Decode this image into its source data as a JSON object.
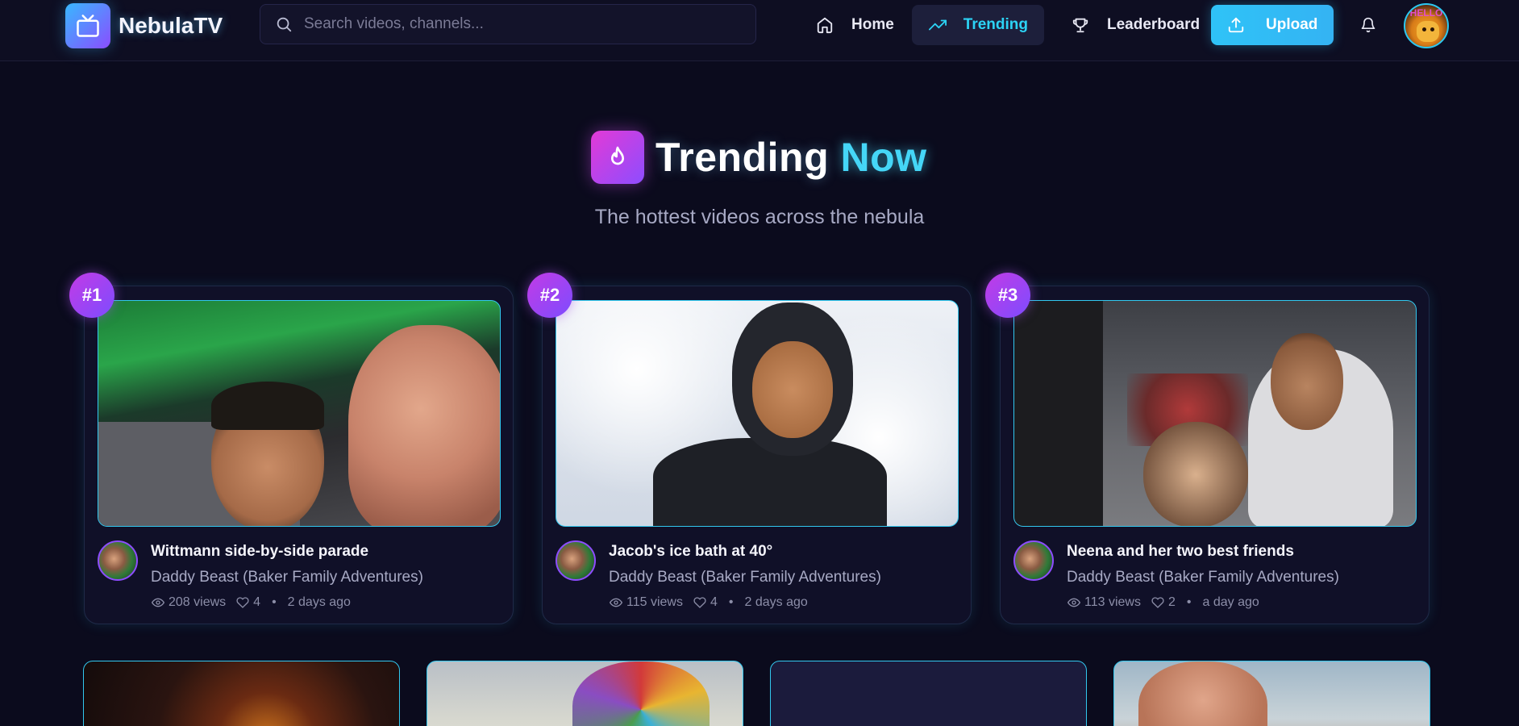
{
  "header": {
    "logo_text": "NebulaTV",
    "search_placeholder": "Search videos, channels...",
    "nav": {
      "home": "Home",
      "trending": "Trending",
      "leaderboard": "Leaderboard",
      "upload": "Upload"
    },
    "avatar_badge": "HELLO"
  },
  "hero": {
    "title_main": "Trending",
    "title_accent": "Now",
    "subtitle": "The hottest videos across the nebula"
  },
  "trending": [
    {
      "rank": "#1",
      "title": "Wittmann side-by-side parade",
      "channel": "Daddy Beast (Baker Family Adventures)",
      "views": "208 views",
      "likes": "4",
      "age": "2 days ago"
    },
    {
      "rank": "#2",
      "title": "Jacob's ice bath at 40°",
      "channel": "Daddy Beast (Baker Family Adventures)",
      "views": "115 views",
      "likes": "4",
      "age": "2 days ago"
    },
    {
      "rank": "#3",
      "title": "Neena and her two best friends",
      "channel": "Daddy Beast (Baker Family Adventures)",
      "views": "113 views",
      "likes": "2",
      "age": "a day ago"
    }
  ],
  "separator": "•",
  "colors": {
    "background": "#0b0b1d",
    "accent_cyan": "#2cd3f5",
    "accent_purple": "#8d4dff",
    "accent_pink": "#e33ad6"
  }
}
